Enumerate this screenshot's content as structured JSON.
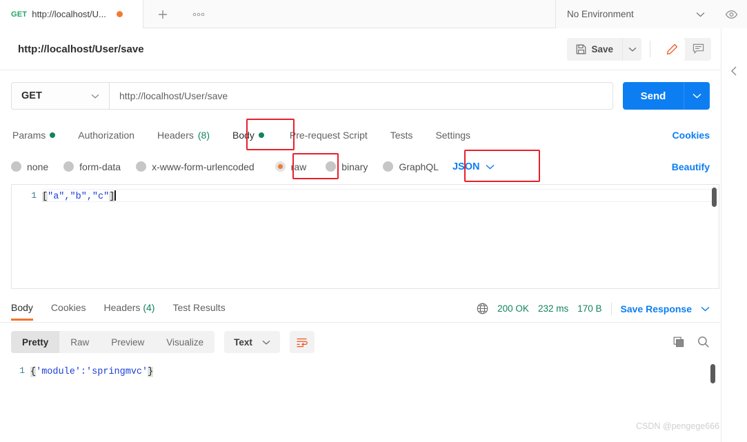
{
  "tab": {
    "method": "GET",
    "title": "http://localhost/U...",
    "unsaved_dot": "unsaved-indicator",
    "new_tab_label": "+",
    "more_label": "ooo"
  },
  "environment": {
    "selected": "No Environment"
  },
  "request_header": {
    "title": "http://localhost/User/save",
    "save_label": "Save",
    "save_caret": "⌄",
    "edit_icon": "pencil-icon",
    "comment_icon": "comment-icon"
  },
  "url_bar": {
    "method": "GET",
    "method_caret": "⌄",
    "url": "http://localhost/User/save",
    "send_label": "Send",
    "send_caret": "⌄"
  },
  "request_tabs": [
    {
      "label": "Params",
      "dot": true,
      "count": "",
      "selected": false
    },
    {
      "label": "Authorization",
      "dot": false,
      "count": "",
      "selected": false
    },
    {
      "label": "Headers",
      "dot": false,
      "count": "(8)",
      "selected": false
    },
    {
      "label": "Body",
      "dot": true,
      "count": "",
      "selected": true
    },
    {
      "label": "Pre-request Script",
      "dot": false,
      "count": "",
      "selected": false
    },
    {
      "label": "Tests",
      "dot": false,
      "count": "",
      "selected": false
    },
    {
      "label": "Settings",
      "dot": false,
      "count": "",
      "selected": false
    }
  ],
  "cookies_link": "Cookies",
  "body_types": [
    {
      "label": "none",
      "selected": false
    },
    {
      "label": "form-data",
      "selected": false
    },
    {
      "label": "x-www-form-urlencoded",
      "selected": false
    },
    {
      "label": "raw",
      "selected": true
    },
    {
      "label": "binary",
      "selected": false
    },
    {
      "label": "GraphQL",
      "selected": false
    }
  ],
  "raw_format": {
    "value": "JSON",
    "caret": "⌄"
  },
  "beautify_link": "Beautify",
  "request_body": {
    "line_number": "1",
    "open_bracket": "[",
    "content": "\"a\",\"b\",\"c\"",
    "close_bracket": "]",
    "full_text": "[\"a\",\"b\",\"c\"]"
  },
  "response_tabs": [
    {
      "label": "Body",
      "count": "",
      "selected": true
    },
    {
      "label": "Cookies",
      "count": "",
      "selected": false
    },
    {
      "label": "Headers",
      "count": "(4)",
      "selected": false
    },
    {
      "label": "Test Results",
      "count": "",
      "selected": false
    }
  ],
  "response_meta": {
    "globe_icon": "globe-icon",
    "status": "200 OK",
    "time": "232 ms",
    "size": "170 B",
    "save_response": "Save Response",
    "save_response_caret": "⌄"
  },
  "response_view": {
    "modes": [
      {
        "label": "Pretty",
        "selected": true
      },
      {
        "label": "Raw",
        "selected": false
      },
      {
        "label": "Preview",
        "selected": false
      },
      {
        "label": "Visualize",
        "selected": false
      }
    ],
    "format": "Text",
    "format_caret": "⌄",
    "wrap_icon": "word-wrap-icon",
    "copy_icon": "copy-icon",
    "search_icon": "search-icon"
  },
  "response_body": {
    "line_number": "1",
    "open_brace": "{",
    "content": "'module':'springmvc'",
    "close_brace": "}",
    "full_text": "{'module':'springmvc'}"
  },
  "annotations": {
    "highlight_color": "#e8202a",
    "boxes": [
      "body-tab",
      "raw-radio",
      "json-format-select"
    ]
  },
  "watermark": "CSDN @pengege666",
  "colors": {
    "accent_blue": "#0d7ef2",
    "accent_orange": "#f07c34",
    "green": "#11845b",
    "annotation_red": "#e8202a"
  }
}
